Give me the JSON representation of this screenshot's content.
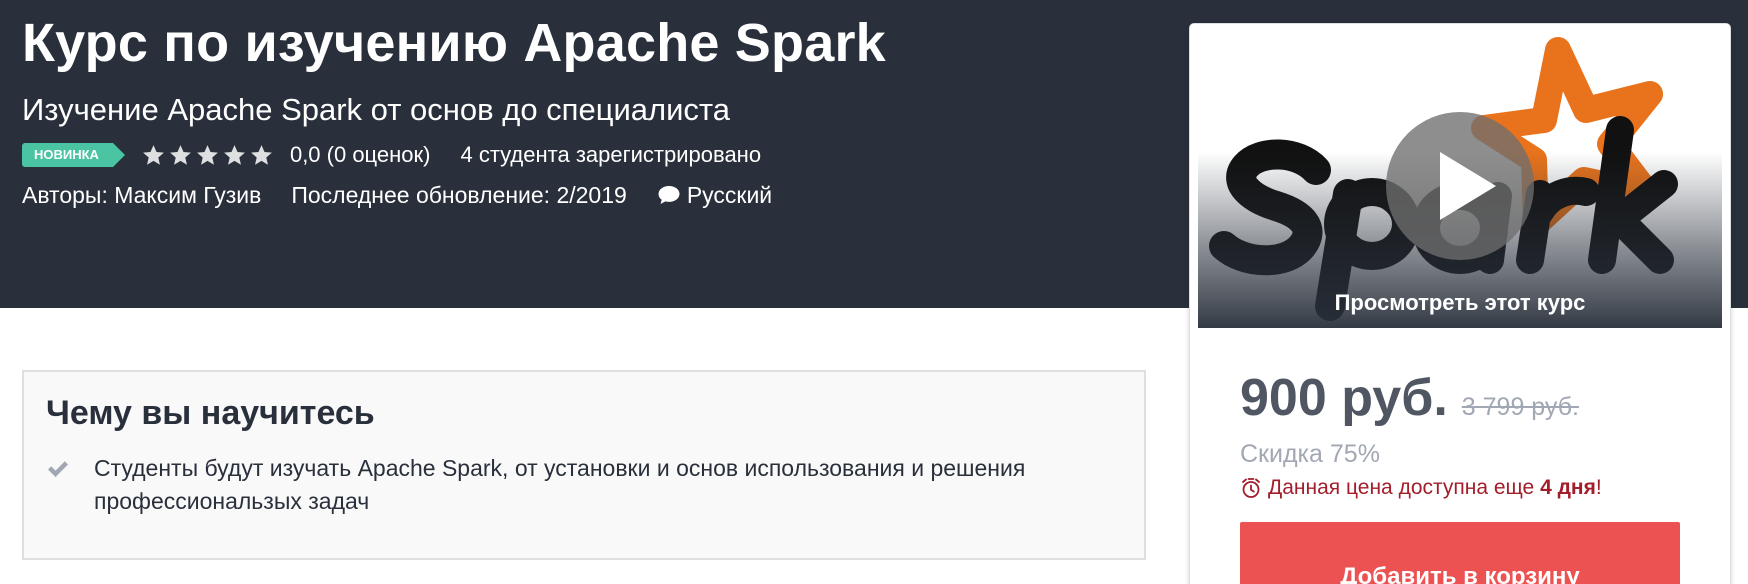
{
  "header": {
    "title": "Курс по изучению Apache Spark",
    "subtitle": "Изучение Apache Spark от основ до специалиста",
    "badge": "НОВИНКА",
    "rating_stars": 0,
    "rating_text": "0,0 (0 оценок)",
    "students": "4 студента зарегистрировано",
    "authors": "Авторы: Максим Гузив",
    "updated": "Последнее обновление: 2/2019",
    "language": "Русский"
  },
  "learn": {
    "title": "Чему вы научитесь",
    "items": [
      "Студенты будут изучать Apache Spark, от установки и основ использования и решения профессиональзых задач"
    ]
  },
  "sidebar": {
    "preview_label": "Просмотреть этот курс",
    "preview_image": "spark-logo",
    "price": "900 руб.",
    "old_price": "3 799 руб.",
    "discount": "Скидка 75%",
    "deadline_prefix": "Данная цена доступна еще ",
    "deadline_bold": "4 дня",
    "deadline_suffix": "!",
    "cart_button": "Добавить в корзину"
  },
  "colors": {
    "hero_bg": "#29303b",
    "badge": "#4bc4a4",
    "cart_button": "#ec5252",
    "deadline": "#a31d2a",
    "spark_orange": "#e8731c"
  },
  "icons": [
    "star-icon",
    "chat-bubble-icon",
    "check-icon",
    "play-icon",
    "alarm-clock-icon"
  ]
}
